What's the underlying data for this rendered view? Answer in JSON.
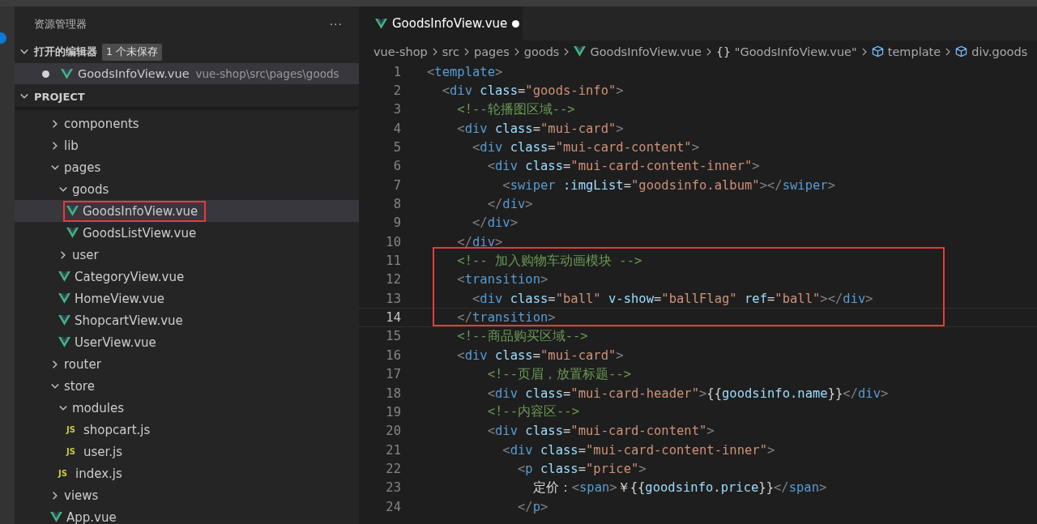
{
  "explorer": {
    "title": "资源管理器",
    "more": "···",
    "open_editors": {
      "label": "打开的编辑器",
      "badge": "1 个未保存",
      "expanded": true,
      "files": [
        {
          "name": "GoodsInfoView.vue",
          "path": "vue-shop\\src\\pages\\goods",
          "kind": "vue",
          "unsaved": true,
          "selected": true
        }
      ]
    },
    "project": {
      "label": "PROJECT",
      "expanded": true
    },
    "tree": [
      {
        "name": "components",
        "kind": "folder",
        "expanded": false
      },
      {
        "name": "lib",
        "kind": "folder",
        "expanded": false
      },
      {
        "name": "pages",
        "kind": "folder",
        "expanded": true,
        "children": [
          {
            "name": "goods",
            "kind": "folder",
            "expanded": true,
            "children": [
              {
                "name": "GoodsInfoView.vue",
                "kind": "vue",
                "selected": true,
                "marked": true
              },
              {
                "name": "GoodsListView.vue",
                "kind": "vue",
                "selected": false,
                "marked": false
              }
            ]
          },
          {
            "name": "user",
            "kind": "folder",
            "expanded": false
          },
          {
            "name": "CategoryView.vue",
            "kind": "vue",
            "selected": false,
            "marked": false
          },
          {
            "name": "HomeView.vue",
            "kind": "vue",
            "selected": false,
            "marked": false
          },
          {
            "name": "ShopcartView.vue",
            "kind": "vue",
            "selected": false,
            "marked": false
          },
          {
            "name": "UserView.vue",
            "kind": "vue",
            "selected": false,
            "marked": false
          }
        ]
      },
      {
        "name": "router",
        "kind": "folder",
        "expanded": false
      },
      {
        "name": "store",
        "kind": "folder",
        "expanded": true,
        "children": [
          {
            "name": "modules",
            "kind": "folder",
            "expanded": true,
            "children": [
              {
                "name": "shopcart.js",
                "kind": "js",
                "badge": "JS",
                "selected": false,
                "marked": false
              },
              {
                "name": "user.js",
                "kind": "js",
                "badge": "JS",
                "selected": false,
                "marked": false
              }
            ]
          },
          {
            "name": "index.js",
            "kind": "js",
            "badge": "JS",
            "selected": false,
            "marked": false
          }
        ]
      },
      {
        "name": "views",
        "kind": "folder",
        "expanded": false
      },
      {
        "name": "App.vue",
        "kind": "vue",
        "selected": false,
        "marked": false
      }
    ]
  },
  "editor": {
    "tab": {
      "name": "GoodsInfoView.vue",
      "kind": "vue",
      "unsaved": true,
      "selected": true
    },
    "breadcrumbs": [
      {
        "label": "vue-shop",
        "kind": "folder"
      },
      {
        "label": "src",
        "kind": "folder"
      },
      {
        "label": "pages",
        "kind": "folder"
      },
      {
        "label": "goods",
        "kind": "folder"
      },
      {
        "label": "GoodsInfoView.vue",
        "kind": "vue"
      },
      {
        "label": "\"GoodsInfoView.vue\"",
        "kind": "module",
        "glyph": "{}"
      },
      {
        "label": "template",
        "kind": "element"
      },
      {
        "label": "div.goods",
        "kind": "element"
      }
    ],
    "lines": [
      {
        "number": "1",
        "current": false,
        "marked": false,
        "tokens": [
          {
            "kind": "p",
            "text": "<"
          },
          {
            "kind": "tag",
            "text": "template"
          },
          {
            "kind": "p",
            "text": ">"
          }
        ]
      },
      {
        "number": "2",
        "current": false,
        "marked": false,
        "tokens": [
          {
            "kind": "p",
            "text": "  <"
          },
          {
            "kind": "tag",
            "text": "div"
          },
          {
            "kind": "attr",
            "text": " class"
          },
          {
            "kind": "txt",
            "text": "="
          },
          {
            "kind": "str",
            "text": "\"goods-info\""
          },
          {
            "kind": "p",
            "text": ">"
          }
        ]
      },
      {
        "number": "3",
        "current": false,
        "marked": false,
        "tokens": [
          {
            "kind": "com",
            "text": "    <!--轮播图区域-->"
          }
        ]
      },
      {
        "number": "4",
        "current": false,
        "marked": false,
        "tokens": [
          {
            "kind": "p",
            "text": "    <"
          },
          {
            "kind": "tag",
            "text": "div"
          },
          {
            "kind": "attr",
            "text": " class"
          },
          {
            "kind": "txt",
            "text": "="
          },
          {
            "kind": "str",
            "text": "\"mui-card\""
          },
          {
            "kind": "p",
            "text": ">"
          }
        ]
      },
      {
        "number": "5",
        "current": false,
        "marked": false,
        "tokens": [
          {
            "kind": "p",
            "text": "      <"
          },
          {
            "kind": "tag",
            "text": "div"
          },
          {
            "kind": "attr",
            "text": " class"
          },
          {
            "kind": "txt",
            "text": "="
          },
          {
            "kind": "str",
            "text": "\"mui-card-content\""
          },
          {
            "kind": "p",
            "text": ">"
          }
        ]
      },
      {
        "number": "6",
        "current": false,
        "marked": false,
        "tokens": [
          {
            "kind": "p",
            "text": "        <"
          },
          {
            "kind": "tag",
            "text": "div"
          },
          {
            "kind": "attr",
            "text": " class"
          },
          {
            "kind": "txt",
            "text": "="
          },
          {
            "kind": "str",
            "text": "\"mui-card-content-inner\""
          },
          {
            "kind": "p",
            "text": ">"
          }
        ]
      },
      {
        "number": "7",
        "current": false,
        "marked": false,
        "tokens": [
          {
            "kind": "p",
            "text": "          <"
          },
          {
            "kind": "tag",
            "text": "swiper"
          },
          {
            "kind": "attr",
            "text": " :imgList"
          },
          {
            "kind": "txt",
            "text": "="
          },
          {
            "kind": "str",
            "text": "\"goodsinfo.album\""
          },
          {
            "kind": "p",
            "text": "></"
          },
          {
            "kind": "tag",
            "text": "swiper"
          },
          {
            "kind": "p",
            "text": ">"
          }
        ]
      },
      {
        "number": "8",
        "current": false,
        "marked": false,
        "tokens": [
          {
            "kind": "p",
            "text": "        </"
          },
          {
            "kind": "tag",
            "text": "div"
          },
          {
            "kind": "p",
            "text": ">"
          }
        ]
      },
      {
        "number": "9",
        "current": false,
        "marked": false,
        "tokens": [
          {
            "kind": "p",
            "text": "      </"
          },
          {
            "kind": "tag",
            "text": "div"
          },
          {
            "kind": "p",
            "text": ">"
          }
        ]
      },
      {
        "number": "10",
        "current": false,
        "marked": false,
        "tokens": [
          {
            "kind": "p",
            "text": "    </"
          },
          {
            "kind": "tag",
            "text": "div"
          },
          {
            "kind": "p",
            "text": ">"
          }
        ]
      },
      {
        "number": "11",
        "current": false,
        "marked": true,
        "tokens": [
          {
            "kind": "com",
            "text": "    <!-- 加入购物车动画模块 -->"
          }
        ]
      },
      {
        "number": "12",
        "current": false,
        "marked": true,
        "tokens": [
          {
            "kind": "p",
            "text": "    <"
          },
          {
            "kind": "tag",
            "text": "transition"
          },
          {
            "kind": "p",
            "text": ">"
          }
        ]
      },
      {
        "number": "13",
        "current": false,
        "marked": true,
        "tokens": [
          {
            "kind": "p",
            "text": "      <"
          },
          {
            "kind": "tag",
            "text": "div"
          },
          {
            "kind": "attr",
            "text": " class"
          },
          {
            "kind": "txt",
            "text": "="
          },
          {
            "kind": "str",
            "text": "\"ball\""
          },
          {
            "kind": "attr",
            "text": " v-show"
          },
          {
            "kind": "txt",
            "text": "="
          },
          {
            "kind": "str",
            "text": "\"ballFlag\""
          },
          {
            "kind": "attr",
            "text": " ref"
          },
          {
            "kind": "txt",
            "text": "="
          },
          {
            "kind": "str",
            "text": "\"ball\""
          },
          {
            "kind": "p",
            "text": "></"
          },
          {
            "kind": "tag",
            "text": "div"
          },
          {
            "kind": "p",
            "text": ">"
          }
        ]
      },
      {
        "number": "14",
        "current": true,
        "marked": true,
        "tokens": [
          {
            "kind": "p",
            "text": "    </"
          },
          {
            "kind": "tag",
            "text": "transition"
          },
          {
            "kind": "p",
            "text": ">"
          }
        ]
      },
      {
        "number": "15",
        "current": false,
        "marked": false,
        "tokens": [
          {
            "kind": "com",
            "text": "    <!--商品购买区域-->"
          }
        ]
      },
      {
        "number": "16",
        "current": false,
        "marked": false,
        "tokens": [
          {
            "kind": "p",
            "text": "    <"
          },
          {
            "kind": "tag",
            "text": "div"
          },
          {
            "kind": "attr",
            "text": " class"
          },
          {
            "kind": "txt",
            "text": "="
          },
          {
            "kind": "str",
            "text": "\"mui-card\""
          },
          {
            "kind": "p",
            "text": ">"
          }
        ]
      },
      {
        "number": "17",
        "current": false,
        "marked": false,
        "tokens": [
          {
            "kind": "com",
            "text": "        <!--页眉，放置标题-->"
          }
        ]
      },
      {
        "number": "18",
        "current": false,
        "marked": false,
        "tokens": [
          {
            "kind": "p",
            "text": "        <"
          },
          {
            "kind": "tag",
            "text": "div"
          },
          {
            "kind": "attr",
            "text": " class"
          },
          {
            "kind": "txt",
            "text": "="
          },
          {
            "kind": "str",
            "text": "\"mui-card-header\""
          },
          {
            "kind": "p",
            "text": ">"
          },
          {
            "kind": "txt",
            "text": "{{"
          },
          {
            "kind": "var",
            "text": "goodsinfo.name"
          },
          {
            "kind": "txt",
            "text": "}}"
          },
          {
            "kind": "p",
            "text": "</"
          },
          {
            "kind": "tag",
            "text": "div"
          },
          {
            "kind": "p",
            "text": ">"
          }
        ]
      },
      {
        "number": "19",
        "current": false,
        "marked": false,
        "tokens": [
          {
            "kind": "com",
            "text": "        <!--内容区-->"
          }
        ]
      },
      {
        "number": "20",
        "current": false,
        "marked": false,
        "tokens": [
          {
            "kind": "p",
            "text": "        <"
          },
          {
            "kind": "tag",
            "text": "div"
          },
          {
            "kind": "attr",
            "text": " class"
          },
          {
            "kind": "txt",
            "text": "="
          },
          {
            "kind": "str",
            "text": "\"mui-card-content\""
          },
          {
            "kind": "p",
            "text": ">"
          }
        ]
      },
      {
        "number": "21",
        "current": false,
        "marked": false,
        "tokens": [
          {
            "kind": "p",
            "text": "          <"
          },
          {
            "kind": "tag",
            "text": "div"
          },
          {
            "kind": "attr",
            "text": " class"
          },
          {
            "kind": "txt",
            "text": "="
          },
          {
            "kind": "str",
            "text": "\"mui-card-content-inner\""
          },
          {
            "kind": "p",
            "text": ">"
          }
        ]
      },
      {
        "number": "22",
        "current": false,
        "marked": false,
        "tokens": [
          {
            "kind": "p",
            "text": "            <"
          },
          {
            "kind": "tag",
            "text": "p"
          },
          {
            "kind": "attr",
            "text": " class"
          },
          {
            "kind": "txt",
            "text": "="
          },
          {
            "kind": "str",
            "text": "\"price\""
          },
          {
            "kind": "p",
            "text": ">"
          }
        ]
      },
      {
        "number": "23",
        "current": false,
        "marked": false,
        "tokens": [
          {
            "kind": "txt",
            "text": "              定价："
          },
          {
            "kind": "p",
            "text": "<"
          },
          {
            "kind": "tag",
            "text": "span"
          },
          {
            "kind": "p",
            "text": ">"
          },
          {
            "kind": "txt",
            "text": "￥{{"
          },
          {
            "kind": "var",
            "text": "goodsinfo.price"
          },
          {
            "kind": "txt",
            "text": "}}"
          },
          {
            "kind": "p",
            "text": "</"
          },
          {
            "kind": "tag",
            "text": "span"
          },
          {
            "kind": "p",
            "text": ">"
          }
        ]
      },
      {
        "number": "24",
        "current": false,
        "marked": false,
        "tokens": [
          {
            "kind": "p",
            "text": "            </"
          },
          {
            "kind": "tag",
            "text": "p"
          },
          {
            "kind": "p",
            "text": ">"
          }
        ]
      }
    ]
  }
}
